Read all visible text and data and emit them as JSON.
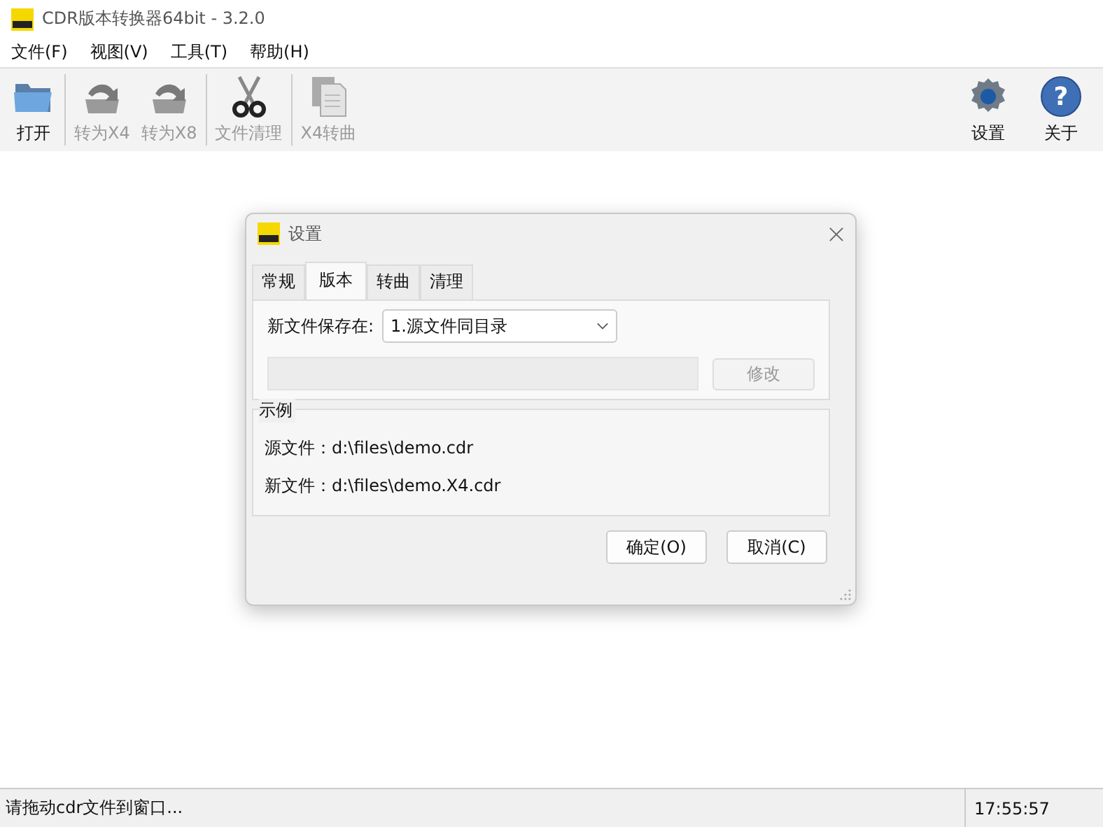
{
  "window": {
    "title": "CDR版本转换器64bit - 3.2.0"
  },
  "menu": [
    "文件(F)",
    "视图(V)",
    "工具(T)",
    "帮助(H)"
  ],
  "toolbar_left": [
    [
      {
        "kind": "folder",
        "label": "打开",
        "disabled": false
      }
    ],
    [
      {
        "kind": "convert",
        "label": "转为X4",
        "disabled": true
      },
      {
        "kind": "convert",
        "label": "转为X8",
        "disabled": true
      }
    ],
    [
      {
        "kind": "scissors",
        "label": "文件清理",
        "disabled": true
      }
    ],
    [
      {
        "kind": "pages",
        "label": "X4转曲",
        "disabled": true
      }
    ]
  ],
  "toolbar_right": [
    {
      "kind": "gear",
      "label": "设置",
      "disabled": false
    },
    {
      "kind": "help",
      "label": "关于",
      "disabled": false,
      "glyph": "?"
    }
  ],
  "dialog": {
    "title": "设置",
    "tabs": [
      {
        "label": "常规",
        "selected": false
      },
      {
        "label": "版本",
        "selected": true
      },
      {
        "label": "转曲",
        "selected": false
      },
      {
        "label": "清理",
        "selected": false
      }
    ],
    "save_label": "新文件保存在:",
    "save_value": "1.源文件同目录",
    "path_field": {
      "disabled": true
    },
    "modify_button": {
      "label": "修改",
      "disabled": true
    },
    "example": {
      "title": "示例",
      "lines": [
        "源文件：d:\\files\\demo.cdr",
        "新文件：d:\\files\\demo.X4.cdr"
      ]
    },
    "buttons": [
      "确定(O)",
      "取消(C)"
    ]
  },
  "status_bar": {
    "message": "请拖动cdr文件到窗口...",
    "time": "17:55:57"
  }
}
